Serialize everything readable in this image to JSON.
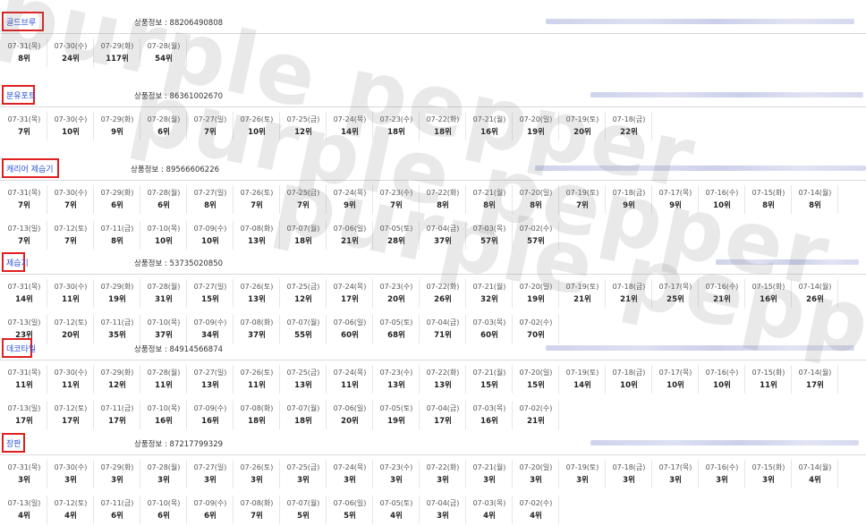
{
  "info_prefix": "상품정보 : ",
  "watermark": "purple pepper",
  "colors": {
    "keyword_border": "#e02020",
    "keyword_text": "#2a4fd7"
  },
  "sections": [
    {
      "keyword": "골드브루",
      "product_code": "88206490808",
      "rows": [
        [
          [
            "07-31(목)",
            "8위"
          ],
          [
            "07-30(수)",
            "24위"
          ],
          [
            "07-29(화)",
            "117위"
          ],
          [
            "07-28(월)",
            "54위"
          ]
        ]
      ]
    },
    {
      "keyword": "분유포트",
      "product_code": "86361002670",
      "rows": [
        [
          [
            "07-31(목)",
            "7위"
          ],
          [
            "07-30(수)",
            "10위"
          ],
          [
            "07-29(화)",
            "9위"
          ],
          [
            "07-28(월)",
            "6위"
          ],
          [
            "07-27(일)",
            "7위"
          ],
          [
            "07-26(토)",
            "10위"
          ],
          [
            "07-25(금)",
            "12위"
          ],
          [
            "07-24(목)",
            "14위"
          ],
          [
            "07-23(수)",
            "18위"
          ],
          [
            "07-22(화)",
            "18위"
          ],
          [
            "07-21(월)",
            "16위"
          ],
          [
            "07-20(일)",
            "19위"
          ],
          [
            "07-19(토)",
            "20위"
          ],
          [
            "07-18(금)",
            "22위"
          ]
        ]
      ]
    },
    {
      "keyword": "캐리어 제습기",
      "product_code": "89566606226",
      "rows": [
        [
          [
            "07-31(목)",
            "7위"
          ],
          [
            "07-30(수)",
            "7위"
          ],
          [
            "07-29(화)",
            "6위"
          ],
          [
            "07-28(월)",
            "6위"
          ],
          [
            "07-27(일)",
            "8위"
          ],
          [
            "07-26(토)",
            "7위"
          ],
          [
            "07-25(금)",
            "7위"
          ],
          [
            "07-24(목)",
            "9위"
          ],
          [
            "07-23(수)",
            "7위"
          ],
          [
            "07-22(화)",
            "8위"
          ],
          [
            "07-21(월)",
            "8위"
          ],
          [
            "07-20(일)",
            "8위"
          ],
          [
            "07-19(토)",
            "7위"
          ],
          [
            "07-18(금)",
            "9위"
          ],
          [
            "07-17(목)",
            "9위"
          ],
          [
            "07-16(수)",
            "10위"
          ],
          [
            "07-15(화)",
            "8위"
          ],
          [
            "07-14(월)",
            "8위"
          ]
        ],
        [
          [
            "07-13(일)",
            "7위"
          ],
          [
            "07-12(토)",
            "7위"
          ],
          [
            "07-11(금)",
            "8위"
          ],
          [
            "07-10(목)",
            "10위"
          ],
          [
            "07-09(수)",
            "10위"
          ],
          [
            "07-08(화)",
            "13위"
          ],
          [
            "07-07(월)",
            "18위"
          ],
          [
            "07-06(일)",
            "21위"
          ],
          [
            "07-05(토)",
            "28위"
          ],
          [
            "07-04(금)",
            "37위"
          ],
          [
            "07-03(목)",
            "57위"
          ],
          [
            "07-02(수)",
            "57위"
          ]
        ]
      ]
    },
    {
      "keyword": "제습기",
      "product_code": "53735020850",
      "rows": [
        [
          [
            "07-31(목)",
            "14위"
          ],
          [
            "07-30(수)",
            "11위"
          ],
          [
            "07-29(화)",
            "19위"
          ],
          [
            "07-28(월)",
            "31위"
          ],
          [
            "07-27(일)",
            "15위"
          ],
          [
            "07-26(토)",
            "13위"
          ],
          [
            "07-25(금)",
            "12위"
          ],
          [
            "07-24(목)",
            "17위"
          ],
          [
            "07-23(수)",
            "20위"
          ],
          [
            "07-22(화)",
            "26위"
          ],
          [
            "07-21(월)",
            "32위"
          ],
          [
            "07-20(일)",
            "19위"
          ],
          [
            "07-19(토)",
            "21위"
          ],
          [
            "07-18(금)",
            "21위"
          ],
          [
            "07-17(목)",
            "25위"
          ],
          [
            "07-16(수)",
            "21위"
          ],
          [
            "07-15(화)",
            "16위"
          ],
          [
            "07-14(월)",
            "26위"
          ]
        ],
        [
          [
            "07-13(일)",
            "23위"
          ],
          [
            "07-12(토)",
            "20위"
          ],
          [
            "07-11(금)",
            "35위"
          ],
          [
            "07-10(목)",
            "37위"
          ],
          [
            "07-09(수)",
            "34위"
          ],
          [
            "07-08(화)",
            "37위"
          ],
          [
            "07-07(월)",
            "55위"
          ],
          [
            "07-06(일)",
            "60위"
          ],
          [
            "07-05(토)",
            "68위"
          ],
          [
            "07-04(금)",
            "71위"
          ],
          [
            "07-03(목)",
            "60위"
          ],
          [
            "07-02(수)",
            "70위"
          ]
        ]
      ]
    },
    {
      "keyword": "데코타일",
      "product_code": "84914566874",
      "rows": [
        [
          [
            "07-31(목)",
            "11위"
          ],
          [
            "07-30(수)",
            "11위"
          ],
          [
            "07-29(화)",
            "12위"
          ],
          [
            "07-28(월)",
            "11위"
          ],
          [
            "07-27(일)",
            "13위"
          ],
          [
            "07-26(토)",
            "11위"
          ],
          [
            "07-25(금)",
            "13위"
          ],
          [
            "07-24(목)",
            "11위"
          ],
          [
            "07-23(수)",
            "13위"
          ],
          [
            "07-22(화)",
            "13위"
          ],
          [
            "07-21(월)",
            "15위"
          ],
          [
            "07-20(일)",
            "15위"
          ],
          [
            "07-19(토)",
            "14위"
          ],
          [
            "07-18(금)",
            "10위"
          ],
          [
            "07-17(목)",
            "10위"
          ],
          [
            "07-16(수)",
            "10위"
          ],
          [
            "07-15(화)",
            "11위"
          ],
          [
            "07-14(월)",
            "17위"
          ]
        ],
        [
          [
            "07-13(일)",
            "17위"
          ],
          [
            "07-12(토)",
            "17위"
          ],
          [
            "07-11(금)",
            "17위"
          ],
          [
            "07-10(목)",
            "16위"
          ],
          [
            "07-09(수)",
            "16위"
          ],
          [
            "07-08(화)",
            "18위"
          ],
          [
            "07-07(월)",
            "18위"
          ],
          [
            "07-06(일)",
            "20위"
          ],
          [
            "07-05(토)",
            "19위"
          ],
          [
            "07-04(금)",
            "17위"
          ],
          [
            "07-03(목)",
            "16위"
          ],
          [
            "07-02(수)",
            "21위"
          ]
        ]
      ]
    },
    {
      "keyword": "장판",
      "product_code": "87217799329",
      "rows": [
        [
          [
            "07-31(목)",
            "3위"
          ],
          [
            "07-30(수)",
            "3위"
          ],
          [
            "07-29(화)",
            "3위"
          ],
          [
            "07-28(월)",
            "3위"
          ],
          [
            "07-27(일)",
            "3위"
          ],
          [
            "07-26(토)",
            "3위"
          ],
          [
            "07-25(금)",
            "3위"
          ],
          [
            "07-24(목)",
            "3위"
          ],
          [
            "07-23(수)",
            "3위"
          ],
          [
            "07-22(화)",
            "3위"
          ],
          [
            "07-21(월)",
            "3위"
          ],
          [
            "07-20(일)",
            "3위"
          ],
          [
            "07-19(토)",
            "3위"
          ],
          [
            "07-18(금)",
            "3위"
          ],
          [
            "07-17(목)",
            "3위"
          ],
          [
            "07-16(수)",
            "3위"
          ],
          [
            "07-15(화)",
            "3위"
          ],
          [
            "07-14(월)",
            "4위"
          ]
        ],
        [
          [
            "07-13(일)",
            "4위"
          ],
          [
            "07-12(토)",
            "4위"
          ],
          [
            "07-11(금)",
            "6위"
          ],
          [
            "07-10(목)",
            "6위"
          ],
          [
            "07-09(수)",
            "6위"
          ],
          [
            "07-08(화)",
            "7위"
          ],
          [
            "07-07(월)",
            "5위"
          ],
          [
            "07-06(일)",
            "5위"
          ],
          [
            "07-05(토)",
            "4위"
          ],
          [
            "07-04(금)",
            "3위"
          ],
          [
            "07-03(목)",
            "4위"
          ],
          [
            "07-02(수)",
            "4위"
          ]
        ]
      ]
    }
  ]
}
